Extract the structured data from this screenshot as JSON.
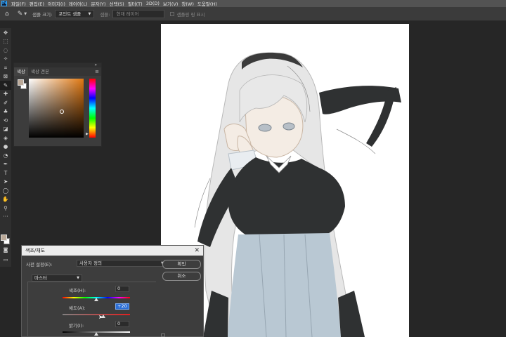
{
  "app": {
    "logo": "Ps",
    "menu": [
      "파일(F)",
      "편집(E)",
      "이미지(I)",
      "레이어(L)",
      "문자(Y)",
      "선택(S)",
      "필터(T)",
      "3D(D)",
      "보기(V)",
      "창(W)",
      "도움말(H)"
    ]
  },
  "options_bar": {
    "home_icon": "home-icon",
    "tool_icon": "eyedropper-icon",
    "sample_size_label": "샘플 크기:",
    "sample_size_value": "포인트 샘플",
    "sample_label": "샘플:",
    "sample_value": "현재 레이어",
    "show_ring_label": "샘플링 링 표시"
  },
  "toolbar": {
    "tools": [
      "move-icon",
      "marquee-icon",
      "lasso-icon",
      "magic-wand-icon",
      "crop-icon",
      "frame-icon",
      "eyedropper-icon",
      "healing-icon",
      "brush-icon",
      "stamp-icon",
      "history-brush-icon",
      "eraser-icon",
      "bucket-icon",
      "blur-icon",
      "dodge-icon",
      "pen-icon",
      "type-icon",
      "path-select-icon",
      "ellipse-icon",
      "hand-icon",
      "zoom-icon",
      "more-icon"
    ],
    "glyphs": [
      "✥",
      "⬚",
      "◌",
      "✧",
      "⌗",
      "⊠",
      "✎",
      "✚",
      "✐",
      "♣",
      "⟲",
      "◪",
      "◈",
      "●",
      "◔",
      "✒",
      "T",
      "➤",
      "◯",
      "✋",
      "⚲",
      "···"
    ],
    "foreground_color": "#bba998",
    "background_color": "#ffffff"
  },
  "color_panel": {
    "tabs": [
      "색상",
      "색상 견본"
    ],
    "active_tab": 0,
    "foreground_color": "#bba998",
    "background_color": "#ffffff",
    "hue_color": "#e07812"
  },
  "hue_saturation_dialog": {
    "title": "색조/채도",
    "preset_label": "사전 설정(E):",
    "preset_value": "사용자 정의",
    "ok_label": "확인",
    "cancel_label": "취소",
    "channel_value": "마스터",
    "hue_label": "색조(H):",
    "hue_value": "0",
    "saturation_label": "채도(A):",
    "saturation_value": "+20",
    "lightness_label": "밝기(I):",
    "lightness_value": "0"
  }
}
